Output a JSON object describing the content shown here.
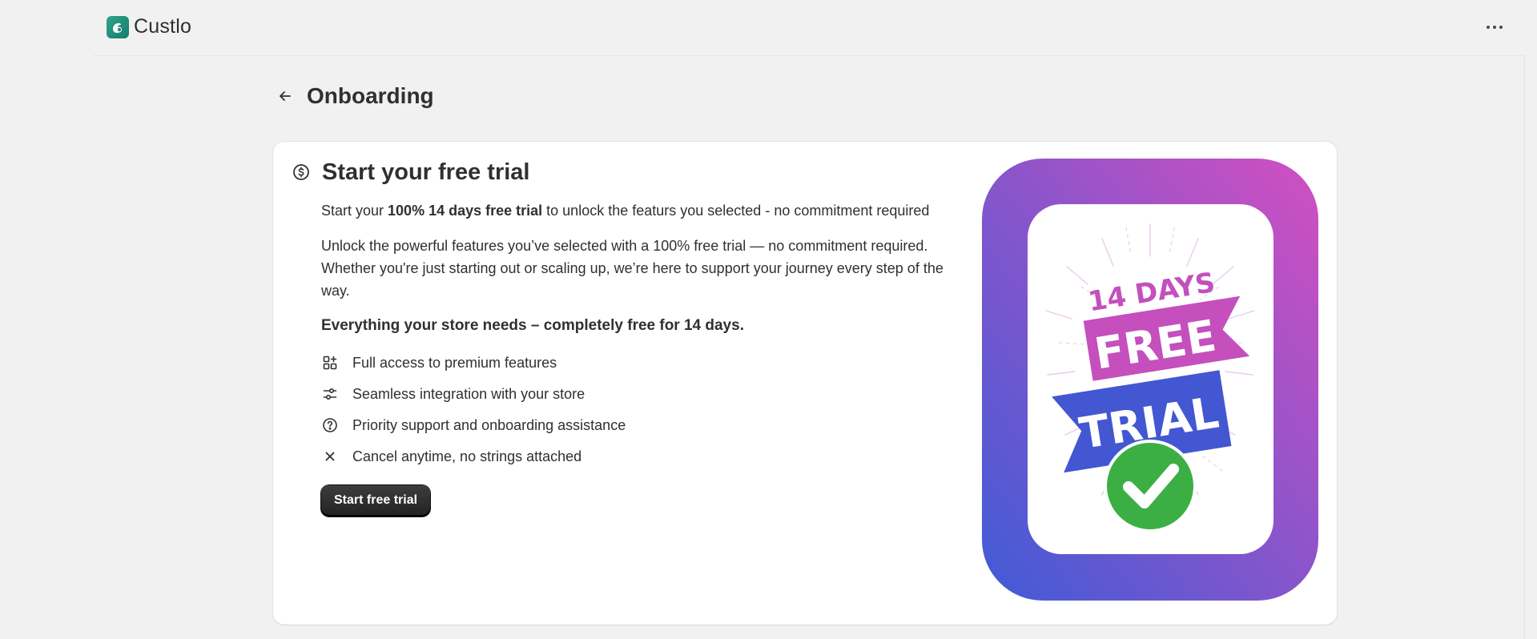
{
  "app": {
    "name": "Custlo"
  },
  "page": {
    "title": "Onboarding"
  },
  "card": {
    "title": "Start your free trial",
    "intro_prefix": "Start your ",
    "intro_bold": "100% 14 days free trial",
    "intro_suffix": " to unlock the featurs you selected - no commitment required",
    "description": "Unlock the powerful features you’ve selected with a 100% free trial — no commitment required. Whether you're just starting out or scaling up, we’re here to support your journey every step of the way.",
    "features_heading": "Everything your store needs – completely free for 14 days.",
    "features": [
      {
        "icon": "apps-icon",
        "label": "Full access to premium features"
      },
      {
        "icon": "sliders-icon",
        "label": "Seamless integration with your store"
      },
      {
        "icon": "question-circle-icon",
        "label": "Priority support and onboarding assistance"
      },
      {
        "icon": "x-icon",
        "label": "Cancel anytime, no strings attached"
      }
    ],
    "cta_label": "Start free trial"
  },
  "promo": {
    "line1": "14 DAYS",
    "line2": "FREE",
    "line3": "TRIAL",
    "colors": {
      "gradient_start": "#3f5bd6",
      "gradient_end": "#d24fc0",
      "pink": "#c44fbd",
      "blue": "#4257d1",
      "green": "#3caf44"
    }
  },
  "colors": {
    "background": "#f1f1f1",
    "card": "#ffffff",
    "text": "#303030",
    "button": "#303030"
  }
}
